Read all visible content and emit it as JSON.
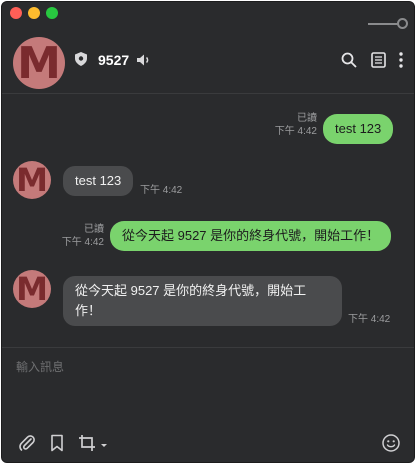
{
  "header": {
    "contact_name": "9527",
    "avatar_letter": "M",
    "icons": [
      "shield-icon",
      "speaker-icon",
      "search-icon",
      "notes-icon",
      "more-icon"
    ]
  },
  "messages": [
    {
      "direction": "out",
      "text": "test 123",
      "read": "已讀",
      "time": "下午 4:42"
    },
    {
      "direction": "in",
      "text": "test 123",
      "time": "下午 4:42"
    },
    {
      "direction": "out",
      "text": "從今天起 9527 是你的終身代號，開始工作！",
      "read": "已讀",
      "time": "下午 4:42"
    },
    {
      "direction": "in",
      "text_line1": "從今天起 9527 是你的終身代號，開始工",
      "text_line2": "作！",
      "time": "下午 4:42"
    }
  ],
  "composer": {
    "placeholder": "輸入訊息"
  },
  "footer": {
    "icons": [
      "paperclip-icon",
      "bookmark-icon",
      "crop-icon",
      "emoji-icon"
    ]
  },
  "colors": {
    "outgoing_bubble": "#7ad36d",
    "incoming_bubble": "#4a4b4d",
    "background": "#2a2b2d"
  }
}
